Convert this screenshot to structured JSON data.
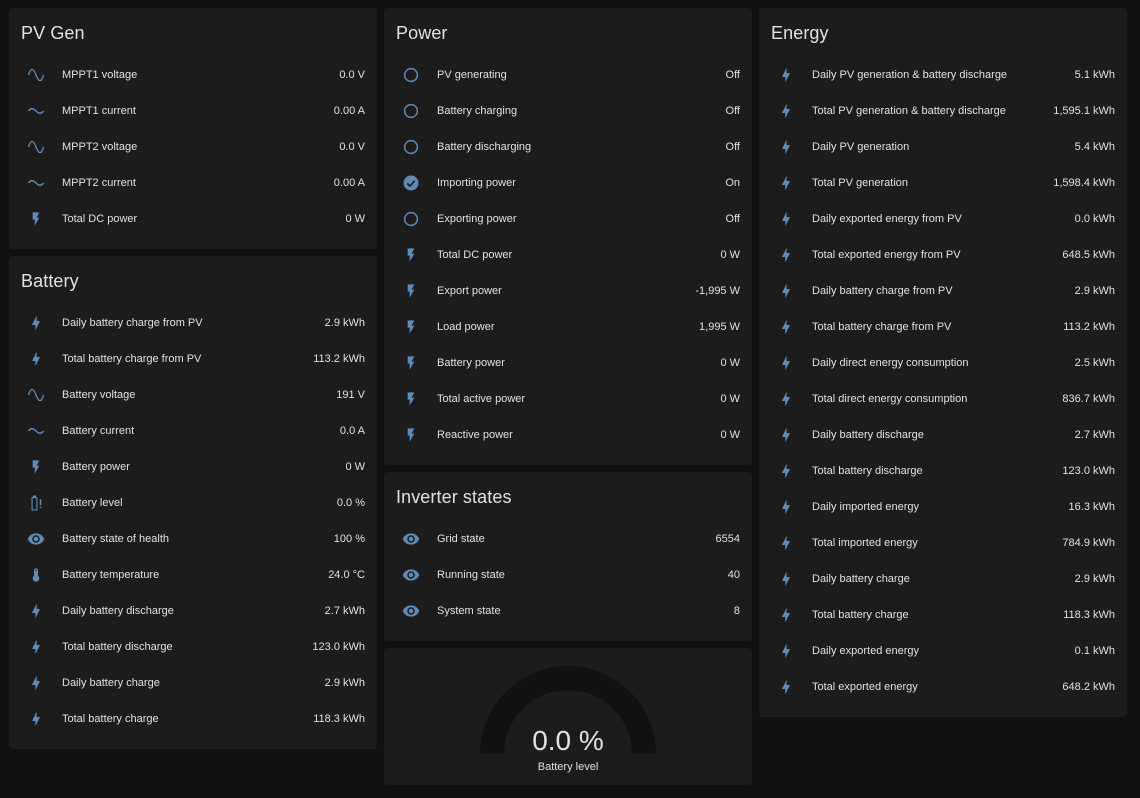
{
  "colors": {
    "icon": "#5e8ab4",
    "card": "#1c1c1c",
    "background": "#111111",
    "gauge_track": "#111111"
  },
  "pv_gen": {
    "title": "PV Gen",
    "rows": [
      {
        "icon": "sine-wave-icon",
        "label": "MPPT1 voltage",
        "value": "0.0 V"
      },
      {
        "icon": "current-ac-icon",
        "label": "MPPT1 current",
        "value": "0.00 A"
      },
      {
        "icon": "sine-wave-icon",
        "label": "MPPT2 voltage",
        "value": "0.0 V"
      },
      {
        "icon": "current-ac-icon",
        "label": "MPPT2 current",
        "value": "0.00 A"
      },
      {
        "icon": "flash-icon",
        "label": "Total DC power",
        "value": "0 W"
      }
    ]
  },
  "battery": {
    "title": "Battery",
    "rows": [
      {
        "icon": "lightning-bolt-icon",
        "label": "Daily battery charge from PV",
        "value": "2.9 kWh"
      },
      {
        "icon": "lightning-bolt-icon",
        "label": "Total battery charge from PV",
        "value": "113.2 kWh"
      },
      {
        "icon": "sine-wave-icon",
        "label": "Battery voltage",
        "value": "191 V"
      },
      {
        "icon": "current-ac-icon",
        "label": "Battery current",
        "value": "0.0 A"
      },
      {
        "icon": "flash-icon",
        "label": "Battery power",
        "value": "0 W"
      },
      {
        "icon": "battery-alert-icon",
        "label": "Battery level",
        "value": "0.0 %"
      },
      {
        "icon": "eye-icon",
        "label": "Battery state of health",
        "value": "100 %"
      },
      {
        "icon": "thermometer-icon",
        "label": "Battery temperature",
        "value": "24.0 °C"
      },
      {
        "icon": "lightning-bolt-icon",
        "label": "Daily battery discharge",
        "value": "2.7 kWh"
      },
      {
        "icon": "lightning-bolt-icon",
        "label": "Total battery discharge",
        "value": "123.0 kWh"
      },
      {
        "icon": "lightning-bolt-icon",
        "label": "Daily battery charge",
        "value": "2.9 kWh"
      },
      {
        "icon": "lightning-bolt-icon",
        "label": "Total battery charge",
        "value": "118.3 kWh"
      }
    ]
  },
  "power": {
    "title": "Power",
    "rows": [
      {
        "icon": "radio-off-icon",
        "label": "PV generating",
        "value": "Off"
      },
      {
        "icon": "radio-off-icon",
        "label": "Battery charging",
        "value": "Off"
      },
      {
        "icon": "radio-off-icon",
        "label": "Battery discharging",
        "value": "Off"
      },
      {
        "icon": "check-circle-icon",
        "label": "Importing power",
        "value": "On"
      },
      {
        "icon": "radio-off-icon",
        "label": "Exporting power",
        "value": "Off"
      },
      {
        "icon": "flash-icon",
        "label": "Total DC power",
        "value": "0 W"
      },
      {
        "icon": "flash-icon",
        "label": "Export power",
        "value": "-1,995 W"
      },
      {
        "icon": "flash-icon",
        "label": "Load power",
        "value": "1,995 W"
      },
      {
        "icon": "flash-icon",
        "label": "Battery power",
        "value": "0 W"
      },
      {
        "icon": "flash-icon",
        "label": "Total active power",
        "value": "0 W"
      },
      {
        "icon": "flash-icon",
        "label": "Reactive power",
        "value": "0 W"
      }
    ]
  },
  "inverter_states": {
    "title": "Inverter states",
    "rows": [
      {
        "icon": "eye-icon",
        "label": "Grid state",
        "value": "6554"
      },
      {
        "icon": "eye-icon",
        "label": "Running state",
        "value": "40"
      },
      {
        "icon": "eye-icon",
        "label": "System state",
        "value": "8"
      }
    ]
  },
  "gauge": {
    "value": "0.0 %",
    "name": "Battery level",
    "level": 0
  },
  "energy": {
    "title": "Energy",
    "rows": [
      {
        "icon": "lightning-bolt-icon",
        "label": "Daily PV generation & battery discharge",
        "value": "5.1 kWh"
      },
      {
        "icon": "lightning-bolt-icon",
        "label": "Total PV generation & battery discharge",
        "value": "1,595.1 kWh"
      },
      {
        "icon": "lightning-bolt-icon",
        "label": "Daily PV generation",
        "value": "5.4 kWh"
      },
      {
        "icon": "lightning-bolt-icon",
        "label": "Total PV generation",
        "value": "1,598.4 kWh"
      },
      {
        "icon": "lightning-bolt-icon",
        "label": "Daily exported energy from PV",
        "value": "0.0 kWh"
      },
      {
        "icon": "lightning-bolt-icon",
        "label": "Total exported energy from PV",
        "value": "648.5 kWh"
      },
      {
        "icon": "lightning-bolt-icon",
        "label": "Daily battery charge from PV",
        "value": "2.9 kWh"
      },
      {
        "icon": "lightning-bolt-icon",
        "label": "Total battery charge from PV",
        "value": "113.2 kWh"
      },
      {
        "icon": "lightning-bolt-icon",
        "label": "Daily direct energy consumption",
        "value": "2.5 kWh"
      },
      {
        "icon": "lightning-bolt-icon",
        "label": "Total direct energy consumption",
        "value": "836.7 kWh"
      },
      {
        "icon": "lightning-bolt-icon",
        "label": "Daily battery discharge",
        "value": "2.7 kWh"
      },
      {
        "icon": "lightning-bolt-icon",
        "label": "Total battery discharge",
        "value": "123.0 kWh"
      },
      {
        "icon": "lightning-bolt-icon",
        "label": "Daily imported energy",
        "value": "16.3 kWh"
      },
      {
        "icon": "lightning-bolt-icon",
        "label": "Total imported energy",
        "value": "784.9 kWh"
      },
      {
        "icon": "lightning-bolt-icon",
        "label": "Daily battery charge",
        "value": "2.9 kWh"
      },
      {
        "icon": "lightning-bolt-icon",
        "label": "Total battery charge",
        "value": "118.3 kWh"
      },
      {
        "icon": "lightning-bolt-icon",
        "label": "Daily exported energy",
        "value": "0.1 kWh"
      },
      {
        "icon": "lightning-bolt-icon",
        "label": "Total exported energy",
        "value": "648.2 kWh"
      }
    ]
  }
}
